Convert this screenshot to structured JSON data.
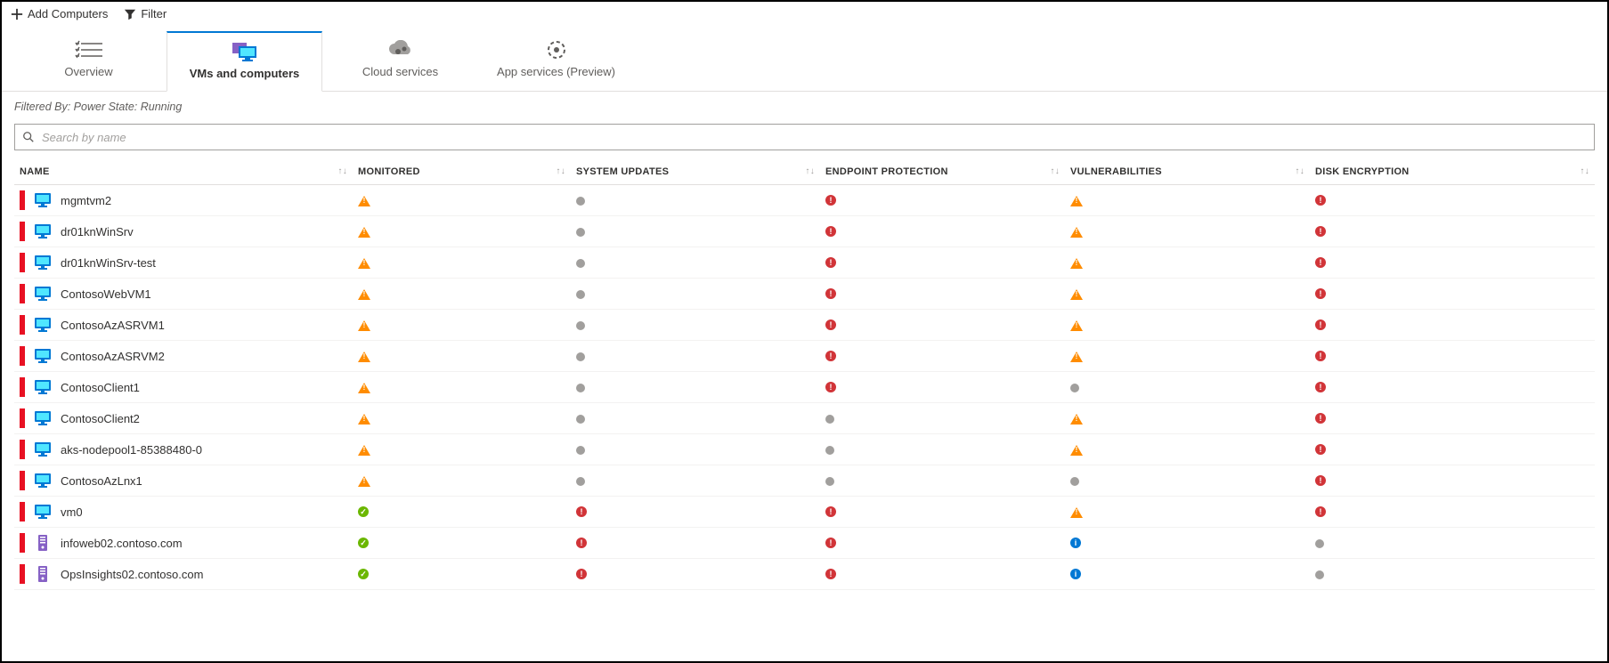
{
  "toolbar": {
    "add_label": "Add Computers",
    "filter_label": "Filter"
  },
  "tabs": [
    {
      "id": "overview",
      "label": "Overview",
      "active": false
    },
    {
      "id": "vms",
      "label": "VMs and computers",
      "active": true
    },
    {
      "id": "cloud",
      "label": "Cloud services",
      "active": false
    },
    {
      "id": "appsvc",
      "label": "App services (Preview)",
      "active": false
    }
  ],
  "filtered_by": "Filtered By: Power State: Running",
  "search": {
    "placeholder": "Search by name"
  },
  "columns": {
    "name": "NAME",
    "monitored": "MONITORED",
    "system_updates": "SYSTEM UPDATES",
    "endpoint_protection": "ENDPOINT PROTECTION",
    "vulnerabilities": "VULNERABILITIES",
    "disk_encryption": "DISK ENCRYPTION"
  },
  "rows": [
    {
      "name": "mgmtvm2",
      "type": "vm",
      "monitored": "warn",
      "sys": "gray",
      "ep": "err",
      "vul": "warn",
      "disk": "err"
    },
    {
      "name": "dr01knWinSrv",
      "type": "vm",
      "monitored": "warn",
      "sys": "gray",
      "ep": "err",
      "vul": "warn",
      "disk": "err"
    },
    {
      "name": "dr01knWinSrv-test",
      "type": "vm",
      "monitored": "warn",
      "sys": "gray",
      "ep": "err",
      "vul": "warn",
      "disk": "err"
    },
    {
      "name": "ContosoWebVM1",
      "type": "vm",
      "monitored": "warn",
      "sys": "gray",
      "ep": "err",
      "vul": "warn",
      "disk": "err"
    },
    {
      "name": "ContosoAzASRVM1",
      "type": "vm",
      "monitored": "warn",
      "sys": "gray",
      "ep": "err",
      "vul": "warn",
      "disk": "err"
    },
    {
      "name": "ContosoAzASRVM2",
      "type": "vm",
      "monitored": "warn",
      "sys": "gray",
      "ep": "err",
      "vul": "warn",
      "disk": "err"
    },
    {
      "name": "ContosoClient1",
      "type": "vm",
      "monitored": "warn",
      "sys": "gray",
      "ep": "err",
      "vul": "gray",
      "disk": "err"
    },
    {
      "name": "ContosoClient2",
      "type": "vm",
      "monitored": "warn",
      "sys": "gray",
      "ep": "gray",
      "vul": "warn",
      "disk": "err"
    },
    {
      "name": "aks-nodepool1-85388480-0",
      "type": "vm",
      "monitored": "warn",
      "sys": "gray",
      "ep": "gray",
      "vul": "warn",
      "disk": "err"
    },
    {
      "name": "ContosoAzLnx1",
      "type": "vm",
      "monitored": "warn",
      "sys": "gray",
      "ep": "gray",
      "vul": "gray",
      "disk": "err"
    },
    {
      "name": "vm0",
      "type": "vm",
      "monitored": "ok",
      "sys": "err",
      "ep": "err",
      "vul": "warn",
      "disk": "err"
    },
    {
      "name": "infoweb02.contoso.com",
      "type": "server",
      "monitored": "ok",
      "sys": "err",
      "ep": "err",
      "vul": "info",
      "disk": "gray"
    },
    {
      "name": "OpsInsights02.contoso.com",
      "type": "server",
      "monitored": "ok",
      "sys": "err",
      "ep": "err",
      "vul": "info",
      "disk": "gray"
    }
  ]
}
